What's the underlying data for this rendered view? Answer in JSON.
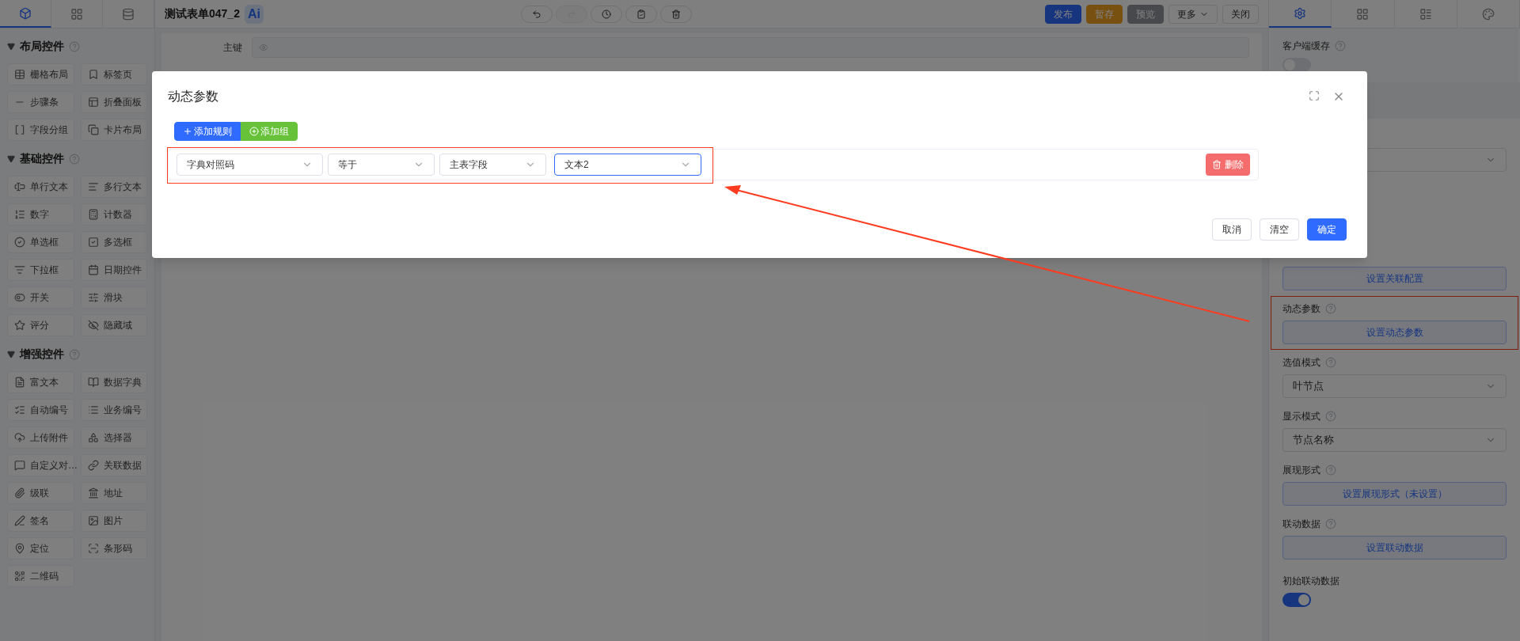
{
  "left_tabs": [
    {
      "selected": true
    },
    {
      "selected": false
    },
    {
      "selected": false
    }
  ],
  "sidebar": {
    "sections": [
      {
        "title": "布局控件",
        "items": [
          "栅格布局",
          "标签页",
          "步骤条",
          "折叠面板",
          "字段分组",
          "卡片布局"
        ]
      },
      {
        "title": "基础控件",
        "items": [
          "单行文本",
          "多行文本",
          "数字",
          "计数器",
          "单选框",
          "多选框",
          "下拉框",
          "日期控件",
          "开关",
          "滑块",
          "评分",
          "隐藏域"
        ]
      },
      {
        "title": "增强控件",
        "items": [
          "富文本",
          "数据字典",
          "自动编号",
          "业务编号",
          "上传附件",
          "选择器",
          "自定义对…",
          "关联数据",
          "级联",
          "地址",
          "签名",
          "图片",
          "定位",
          "条形码",
          "二维码"
        ]
      }
    ]
  },
  "title": "测试表单047_2",
  "ai_badge": "Ai",
  "toolbar": [
    {
      "disabled": false
    },
    {
      "disabled": true
    },
    {
      "disabled": false
    },
    {
      "disabled": false
    },
    {
      "disabled": false
    }
  ],
  "actions": [
    {
      "label": "发布",
      "kind": "primary"
    },
    {
      "label": "暂存",
      "kind": "warning"
    },
    {
      "label": "预览",
      "kind": "info"
    },
    {
      "label": "更多",
      "kind": "dropdown"
    },
    {
      "label": "关闭",
      "kind": "plain"
    }
  ],
  "canvas": {
    "fields": [
      {
        "label": "主键"
      }
    ]
  },
  "right_tabs": [
    {
      "selected": true
    },
    {
      "selected": false
    },
    {
      "selected": false
    },
    {
      "selected": false
    }
  ],
  "right_panel": [
    {
      "kind": "toggle",
      "label": "客户端缓存",
      "on": false
    },
    {
      "kind": "band"
    },
    {
      "kind": "select"
    },
    {
      "kind": "button",
      "button": "设置关联配置",
      "highlighted": false
    },
    {
      "kind": "button",
      "label": "动态参数",
      "button": "设置动态参数",
      "highlighted": true
    },
    {
      "kind": "select",
      "label": "选值模式",
      "value": "叶节点"
    },
    {
      "kind": "select",
      "label": "显示模式",
      "value": "节点名称"
    },
    {
      "kind": "button",
      "label": "展现形式",
      "button": "设置展现形式（未设置）",
      "highlighted": false
    },
    {
      "kind": "button",
      "label": "联动数据",
      "button": "设置联动数据",
      "highlighted": false
    },
    {
      "kind": "toggle",
      "label": "初始联动数据",
      "on": true
    }
  ],
  "dialog": {
    "title": "动态参数",
    "add_buttons": [
      {
        "label": "添加规则",
        "kind": "primary"
      },
      {
        "label": "添加组",
        "kind": "success"
      }
    ],
    "rule": {
      "highlighted": true,
      "selects": [
        {
          "value": "字典对照码",
          "focused": false
        },
        {
          "value": "等于",
          "focused": false
        },
        {
          "value": "主表字段",
          "focused": false
        },
        {
          "value": "文本2",
          "focused": true
        }
      ],
      "delete": "删除"
    },
    "footer": [
      {
        "label": "取消",
        "kind": "plain"
      },
      {
        "label": "清空",
        "kind": "plain"
      },
      {
        "label": "确定",
        "kind": "primary"
      }
    ]
  }
}
